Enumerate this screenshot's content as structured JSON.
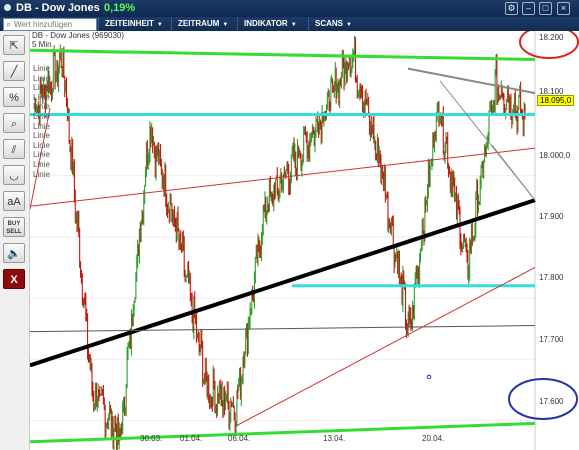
{
  "window": {
    "title": "DB - Dow Jones",
    "change": "0,19%",
    "colors": {
      "titlebar": "#0b2a53",
      "change": "#55ff55"
    }
  },
  "toolbar": {
    "search_placeholder": "Wert hinzufügen",
    "menus": [
      "ZEITEINHEIT",
      "ZEITRAUM",
      "INDIKATOR",
      "SCANS"
    ]
  },
  "sidebar": {
    "tools": [
      "pointer-add",
      "line",
      "percent",
      "zoom",
      "parallel",
      "arc",
      "aA",
      "BUY SELL",
      "sound",
      "X"
    ],
    "buy_sell": [
      "BUY",
      "SELL"
    ],
    "text_label": "aA",
    "close_label": "X"
  },
  "chart_info": {
    "line1": "DB - Dow Jones (969030)",
    "line2": "5 Min",
    "linie_labels": [
      "Linie",
      "Linie",
      "Linie",
      "Linie",
      "Linie",
      "Linie",
      "Linie",
      "Linie",
      "Linie",
      "Linie",
      "Linie",
      "Linie"
    ]
  },
  "chart_data": {
    "type": "line",
    "title": "DB - Dow Jones (969030)",
    "interval": "5 Min",
    "y_ticks": [
      17600,
      17700,
      17800,
      17900,
      18000,
      18100,
      18200
    ],
    "y_tick_labels": [
      "17.600",
      "17.700",
      "17.800",
      "17.900",
      "18.000,0",
      "18.100",
      "18.200"
    ],
    "ylim": [
      17545,
      18230
    ],
    "x_tick_labels": [
      "30.03.",
      "01.04.",
      "06.04.",
      "13.04.",
      "20.04."
    ],
    "current_price": "18.095,0",
    "approx_path": [
      {
        "d": "start",
        "y": 18110
      },
      {
        "d": "peak",
        "y": 18190
      },
      {
        "d": "late 26.03.",
        "y": 17650
      },
      {
        "d": "27.03.",
        "y": 17570
      },
      {
        "d": "31.03.",
        "y": 18080
      },
      {
        "d": "01.04.",
        "y": 17900
      },
      {
        "d": "02.04.",
        "y": 17650
      },
      {
        "d": "06.04.",
        "y": 17620
      },
      {
        "d": "08.04.",
        "y": 17950
      },
      {
        "d": "13.04.",
        "y": 18020
      },
      {
        "d": "14.04.",
        "y": 18100
      },
      {
        "d": "16.04.",
        "y": 18200
      },
      {
        "d": "17.04.",
        "y": 18020
      },
      {
        "d": "20.04.",
        "y": 17740
      },
      {
        "d": "21.04.",
        "y": 18120
      },
      {
        "d": "22.04.",
        "y": 17850
      },
      {
        "d": "23.04.",
        "y": 18150
      },
      {
        "d": "end",
        "y": 18095
      }
    ],
    "drawn_lines": [
      {
        "color": "#33dd33",
        "label": "resistance"
      },
      {
        "color": "#33dd33",
        "label": "support"
      },
      {
        "color": "#33dddd",
        "label": "level 18.100"
      },
      {
        "color": "#33dddd",
        "label": "level 17.820"
      },
      {
        "color": "#000000",
        "label": "trend line"
      },
      {
        "color": "#cc3333",
        "label": "trend channel"
      },
      {
        "color": "#777777",
        "label": "resistance trend"
      }
    ],
    "annotations": [
      {
        "shape": "ellipse",
        "color": "#dd2222",
        "near": "18.200"
      },
      {
        "shape": "ellipse",
        "color": "#2233aa",
        "near": "17.600"
      }
    ],
    "grid": true
  }
}
